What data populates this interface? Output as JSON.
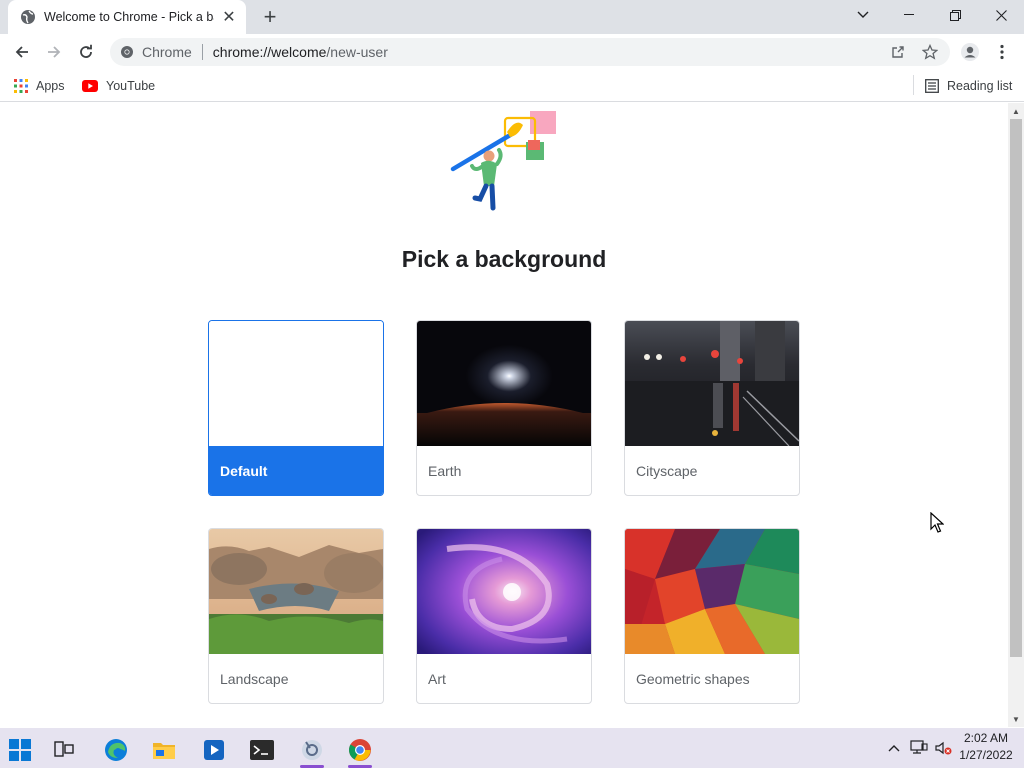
{
  "tab": {
    "title": "Welcome to Chrome - Pick a background",
    "favicon": "globe-icon"
  },
  "omnibox": {
    "site": "Chrome",
    "url_host": "chrome://welcome",
    "url_path": "/new-user"
  },
  "bookmarks": {
    "apps_label": "Apps",
    "youtube_label": "YouTube",
    "reading_list_label": "Reading list"
  },
  "page": {
    "title": "Pick a background"
  },
  "backgrounds": [
    {
      "label": "Default",
      "selected": true
    },
    {
      "label": "Earth",
      "selected": false
    },
    {
      "label": "Cityscape",
      "selected": false
    },
    {
      "label": "Landscape",
      "selected": false
    },
    {
      "label": "Art",
      "selected": false
    },
    {
      "label": "Geometric shapes",
      "selected": false
    }
  ],
  "taskbar": {
    "time": "2:02 AM",
    "date": "1/27/2022"
  },
  "colors": {
    "accent": "#1a73e8",
    "tabstrip": "#dee1e6",
    "taskbar": "#e6e3f0"
  }
}
